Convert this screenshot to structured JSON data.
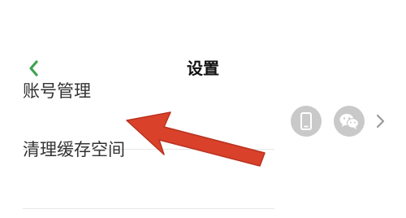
{
  "header": {
    "title": "设置",
    "back_icon": "chevron-left-icon"
  },
  "settings": {
    "items": [
      {
        "label": "账号管理",
        "icons": [
          "phone-icon",
          "wechat-icon",
          "chevron-right-icon"
        ]
      },
      {
        "label": "清理缓存空间"
      }
    ]
  },
  "colors": {
    "accent_green": "#3fa34d",
    "badge_gray": "#c9c9c9",
    "annotation_red": "#d9412b"
  }
}
